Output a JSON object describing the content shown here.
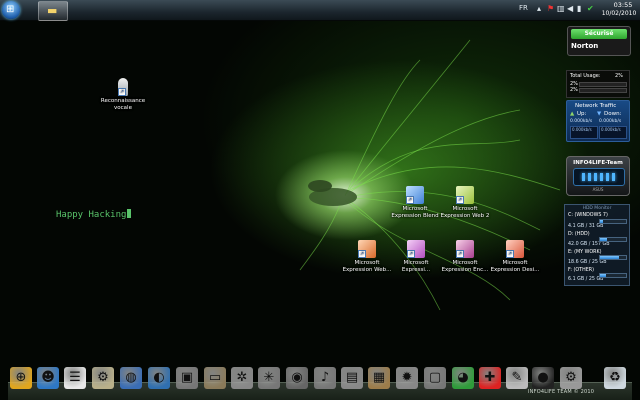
{
  "taskbar": {
    "start_button": "Start",
    "language": "FR",
    "clock_time": "03:55",
    "clock_date": "10/02/2010"
  },
  "desktop": {
    "speech_icon": {
      "line1": "Reconnaissance",
      "line2": "vocale"
    },
    "happy_text": "Happy Hacking",
    "icons": [
      {
        "line1": "Microsoft",
        "line2": "Expression Blend",
        "color": "#3f7fd6"
      },
      {
        "line1": "Microsoft",
        "line2": "Expression Web 2",
        "color": "#9ac03a"
      },
      {
        "line1": "Microsoft",
        "line2": "Expression Web...",
        "color": "#d76a2a"
      },
      {
        "line1": "Microsoft",
        "line2": "Expressi...",
        "color": "#b34fbf"
      },
      {
        "line1": "Microsoft",
        "line2": "Expression Enc...",
        "color": "#a83f8f"
      },
      {
        "line1": "Microsoft",
        "line2": "Expression Desi...",
        "color": "#d9563a"
      }
    ]
  },
  "gadgets": {
    "norton": {
      "status": "Sécurisé",
      "brand": "Norton"
    },
    "cpu": {
      "label": "Total Usage:",
      "value": "2%",
      "core1": "2%",
      "core2": "2%"
    },
    "network": {
      "title": "Network Traffic",
      "up_label": "Up:",
      "down_label": "Down:",
      "up_value": "0.000kb/s",
      "down_value": "0.000kb/s",
      "up_graph": "0.000kb/s",
      "down_graph": "0.000kb/s"
    },
    "team": {
      "title": "INFO4LIFE-Team",
      "subtitle": "ASUS"
    },
    "hdd": {
      "header": "HDD Monitor",
      "drives": [
        {
          "name": "C: (WINDOWS 7)",
          "size": "4.1 GB / 31 GB",
          "fill": 0.13
        },
        {
          "name": "D: (HDD)",
          "size": "42.0 GB / 157 GB",
          "fill": 0.27
        },
        {
          "name": "E: (MY WORK)",
          "size": "18.6 GB / 25 GB",
          "fill": 0.74
        },
        {
          "name": "F: (OTHER)",
          "size": "6.1 GB / 25 GB",
          "fill": 0.24
        }
      ]
    }
  },
  "dock": {
    "caption": "INFO4LIFE TEAM © 2010",
    "items": [
      {
        "icon": "safari-compass-icon",
        "color": "#e0a51d",
        "glyph": "⊕"
      },
      {
        "icon": "messenger-icon",
        "color": "#2e78c6",
        "glyph": "☻"
      },
      {
        "icon": "notepad-icon",
        "color": "#e8e8e8",
        "glyph": "☰"
      },
      {
        "icon": "gears-icon",
        "color": "#b9b08a",
        "glyph": "⚙"
      },
      {
        "icon": "network-globe-icon",
        "color": "#3a6db5",
        "glyph": "◍"
      },
      {
        "icon": "globe-icon",
        "color": "#2f6fb0",
        "glyph": "◐"
      },
      {
        "icon": "camera-icon",
        "color": "#777",
        "glyph": "▣"
      },
      {
        "icon": "folder-icon",
        "color": "#8a7a5a",
        "glyph": "▭"
      },
      {
        "icon": "chip-icon",
        "color": "#888",
        "glyph": "✲"
      },
      {
        "icon": "spider-icon",
        "color": "#777",
        "glyph": "✳"
      },
      {
        "icon": "speaker-icon",
        "color": "#666",
        "glyph": "◉"
      },
      {
        "icon": "microphone-icon",
        "color": "#777",
        "glyph": "♪"
      },
      {
        "icon": "disk-icon",
        "color": "#888",
        "glyph": "▤"
      },
      {
        "icon": "briefcase-icon",
        "color": "#9c7c4a",
        "glyph": "▦"
      },
      {
        "icon": "gear-head-icon",
        "color": "#888",
        "glyph": "✹"
      },
      {
        "icon": "monitor-icon",
        "color": "#777",
        "glyph": "▢"
      },
      {
        "icon": "earth-icon",
        "color": "#2f9b3a",
        "glyph": "◕"
      },
      {
        "icon": "swiss-knife-icon",
        "color": "#d22",
        "glyph": "✚"
      },
      {
        "icon": "tools-icon",
        "color": "#bbb",
        "glyph": "✎"
      },
      {
        "icon": "hacker-mask-icon",
        "color": "#222",
        "glyph": "●"
      },
      {
        "icon": "settings-icon",
        "color": "#999",
        "glyph": "⚙"
      },
      {
        "icon": "recycle-bin-icon",
        "color": "#cfd8df",
        "glyph": "♻"
      }
    ]
  }
}
